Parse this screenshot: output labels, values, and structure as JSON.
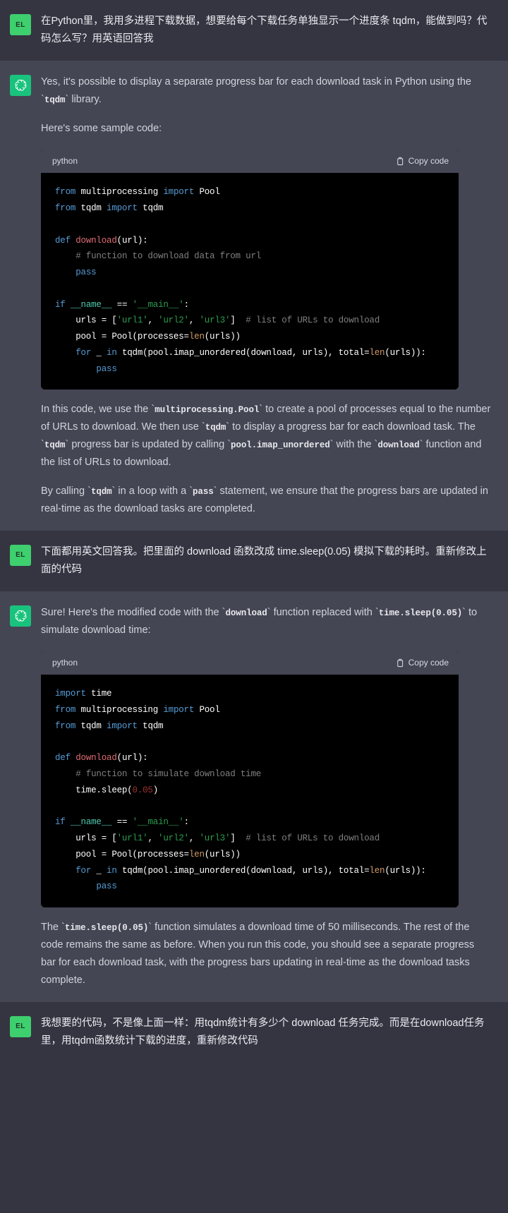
{
  "avatars": {
    "user_initials": "EL",
    "assistant_icon": "openai-logo-icon"
  },
  "code_block": {
    "language_label": "python",
    "copy_label": "Copy code",
    "copy_icon": "clipboard-icon"
  },
  "messages": [
    {
      "role": "user",
      "text": "在Python里，我用多进程下载数据，想要给每个下载任务单独显示一个进度条 tqdm，能做到吗？代码怎么写？用英语回答我"
    },
    {
      "role": "assistant",
      "p1_a": "Yes, it's possible to display a separate progress bar for each download task in Python using the ",
      "p1_code": "tqdm",
      "p1_b": " library.",
      "p2": "Here's some sample code:",
      "code1": {
        "lines": [
          "from multiprocessing import Pool",
          "from tqdm import tqdm",
          "",
          "def download(url):",
          "    # function to download data from url",
          "    pass",
          "",
          "if __name__ == '__main__':",
          "    urls = ['url1', 'url2', 'url3']  # list of URLs to download",
          "    pool = Pool(processes=len(urls))",
          "    for _ in tqdm(pool.imap_unordered(download, urls), total=len(urls)):",
          "        pass"
        ]
      },
      "p3_a": "In this code, we use the ",
      "p3_c1": "multiprocessing.Pool",
      "p3_b": " to create a pool of processes equal to the number of URLs to download. We then use ",
      "p3_c2": "tqdm",
      "p3_c": " to display a progress bar for each download task. The ",
      "p3_c3": "tqdm",
      "p3_d": " progress bar is updated by calling ",
      "p3_c4": "pool.imap_unordered",
      "p3_e": " with the ",
      "p3_c5": "download",
      "p3_f": " function and the list of URLs to download.",
      "p4_a": "By calling ",
      "p4_c1": "tqdm",
      "p4_b": " in a loop with a ",
      "p4_c2": "pass",
      "p4_c": " statement, we ensure that the progress bars are updated in real-time as the download tasks are completed."
    },
    {
      "role": "user",
      "text": "下面都用英文回答我。把里面的 download 函数改成 time.sleep(0.05) 模拟下载的耗时。重新修改上面的代码"
    },
    {
      "role": "assistant",
      "p1_a": "Sure! Here's the modified code with the ",
      "p1_c1": "download",
      "p1_b": " function replaced with ",
      "p1_c2": "time.sleep(0.05)",
      "p1_c": " to simulate download time:",
      "code2": {
        "lines": [
          "import time",
          "from multiprocessing import Pool",
          "from tqdm import tqdm",
          "",
          "def download(url):",
          "    # function to simulate download time",
          "    time.sleep(0.05)",
          "",
          "if __name__ == '__main__':",
          "    urls = ['url1', 'url2', 'url3']  # list of URLs to download",
          "    pool = Pool(processes=len(urls))",
          "    for _ in tqdm(pool.imap_unordered(download, urls), total=len(urls)):",
          "        pass"
        ]
      },
      "p2_a": "The ",
      "p2_c1": "time.sleep(0.05)",
      "p2_b": " function simulates a download time of 50 milliseconds. The rest of the code remains the same as before. When you run this code, you should see a separate progress bar for each download task, with the progress bars updating in real-time as the download tasks complete."
    },
    {
      "role": "user",
      "text": "我想要的代码，不是像上面一样：用tqdm统计有多少个 download 任务完成。而是在download任务里，用tqdm函数统计下载的进度，重新修改代码"
    }
  ],
  "colors": {
    "user_bg": "#343541",
    "assistant_bg": "#444654",
    "user_avatar": "#3ecf6e",
    "assistant_avatar": "#19c37d",
    "code_bg": "#000000"
  }
}
